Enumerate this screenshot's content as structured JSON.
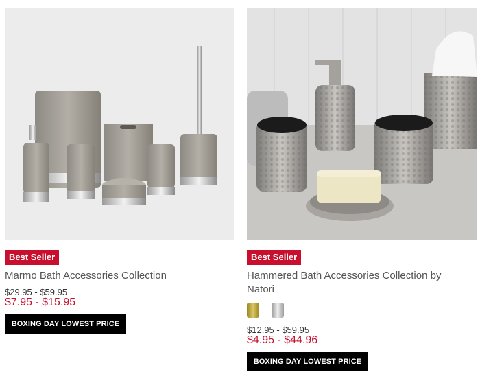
{
  "products": [
    {
      "badge": "Best Seller",
      "title": "Marmo Bath Accessories Collection",
      "regular_price": "$29.95 - $59.95",
      "sale_price": "$7.95 - $15.95",
      "cta": "BOXING DAY LOWEST PRICE",
      "image_icon": "marble-bath-set-photo"
    },
    {
      "badge": "Best Seller",
      "title": "Hammered Bath Accessories Collection by Natori",
      "regular_price": "$12.95 - $59.95",
      "sale_price": "$4.95 - $44.96",
      "cta": "BOXING DAY LOWEST PRICE",
      "image_icon": "hammered-bath-set-photo",
      "swatches": [
        {
          "color": "#b9a23a",
          "icon": "gold-swatch"
        },
        {
          "color": "#c9c9c9",
          "icon": "silver-swatch"
        }
      ]
    }
  ],
  "colors": {
    "badge": "#c8102e",
    "sale_price": "#c8102e",
    "button": "#000000"
  }
}
